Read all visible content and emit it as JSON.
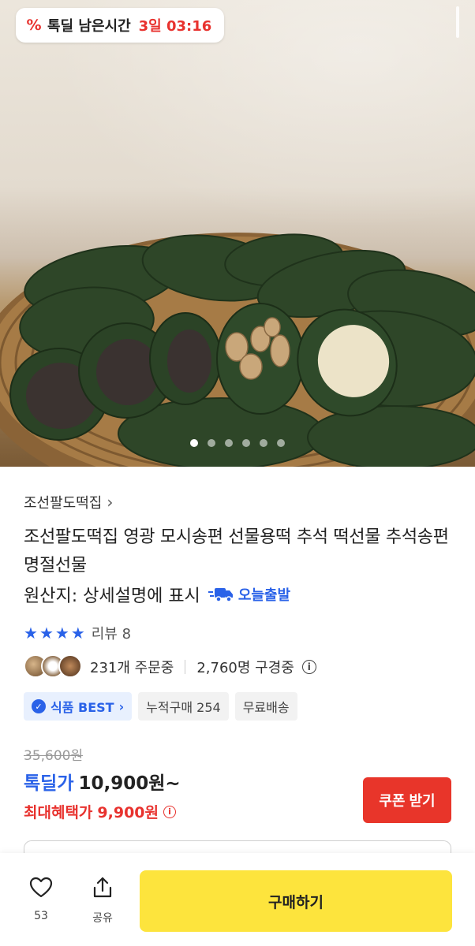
{
  "deal_timer": {
    "label": "톡딜 남은시간",
    "time": "3일 03:16"
  },
  "carousel": {
    "total": 6,
    "active_index": 0
  },
  "product": {
    "store_name": "조선팔도떡집",
    "store_chevron": "›",
    "title": "조선팔도떡집 영광 모시송편 선물용떡 추석 떡선물 추석송편 명절선물",
    "origin": "원산지: 상세설명에 표시",
    "shipping_badge": "오늘출발",
    "rating_stars": 4,
    "review_label": "리뷰 8",
    "orders_text": "231개 주문중",
    "watchers_text": "2,760명 구경중",
    "tags": {
      "best": "식품 BEST",
      "cumulative": "누적구매 254",
      "free_shipping": "무료배송"
    },
    "original_price": "35,600원",
    "deal_label": "톡딜가",
    "deal_price": "10,900원~",
    "max_benefit_label": "최대혜택가",
    "max_benefit_price": "9,900원"
  },
  "buttons": {
    "coupon": "쿠폰 받기",
    "buy": "구매하기",
    "like_count": "53",
    "share": "공유"
  },
  "icons": {
    "deal": "percent-icon",
    "truck": "truck-icon",
    "info": "info-icon",
    "heart": "heart-icon",
    "share": "share-icon"
  },
  "colors": {
    "accent_blue": "#2a62e8",
    "accent_red": "#e8322e",
    "buy_yellow": "#fde43d",
    "coupon_red": "#e8352a"
  }
}
